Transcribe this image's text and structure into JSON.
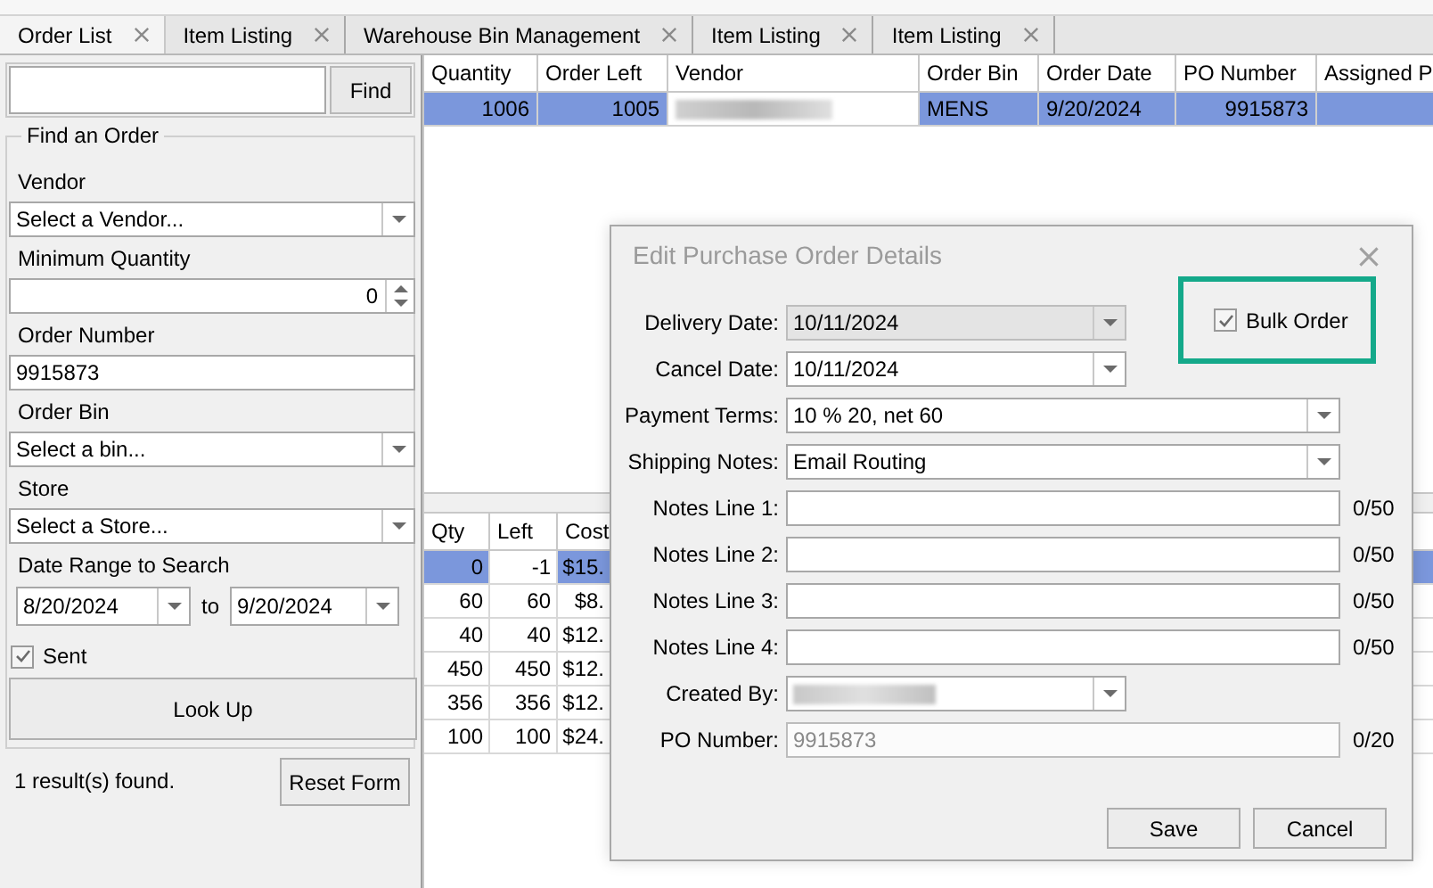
{
  "tabs": [
    {
      "label": "Order List",
      "selected": true
    },
    {
      "label": "Item Listing",
      "selected": false
    },
    {
      "label": "Warehouse Bin Management",
      "selected": false
    },
    {
      "label": "Item Listing",
      "selected": false
    },
    {
      "label": "Item Listing",
      "selected": false
    }
  ],
  "find_button": "Find",
  "filter_group": {
    "title": "Find an Order",
    "fields": [
      {
        "label": "Vendor",
        "kind": "select",
        "value": "Select a Vendor..."
      },
      {
        "label": "Minimum Quantity",
        "kind": "spinner",
        "value": "0"
      },
      {
        "label": "Order Number",
        "kind": "text",
        "value": "9915873"
      },
      {
        "label": "Order Bin",
        "kind": "select",
        "value": "Select a bin..."
      },
      {
        "label": "Store",
        "kind": "select",
        "value": "Select a Store..."
      },
      {
        "label": "Date Range to Search",
        "kind": "date_range",
        "from": "8/20/2024",
        "separator": "to",
        "to": "9/20/2024"
      }
    ],
    "sent": {
      "label": "Sent",
      "checked": true
    },
    "lookup_button": "Look Up"
  },
  "result_text": "1 result(s) found.",
  "reset_button": "Reset Form",
  "orders_table": {
    "columns": [
      "Quantity",
      "Order Left",
      "Vendor",
      "Order Bin",
      "Order Date",
      "PO Number",
      "Assigned P"
    ],
    "rows": [
      {
        "selected": true,
        "cells": [
          {
            "kind": "number",
            "text": "1006",
            "current": false
          },
          {
            "kind": "number",
            "text": "1005",
            "current": false
          },
          {
            "kind": "redacted",
            "current": true
          },
          {
            "kind": "text",
            "text": "MENS",
            "current": false
          },
          {
            "kind": "text",
            "text": "9/20/2024",
            "current": false
          },
          {
            "kind": "number",
            "text": "9915873",
            "current": false
          },
          {
            "kind": "text",
            "current": false
          }
        ]
      }
    ]
  },
  "lines_table": {
    "columns": [
      "Qty",
      "Left",
      "Cost"
    ],
    "rows": [
      {
        "selected": true,
        "cells": [
          {
            "text": "0",
            "current": false
          },
          {
            "text": "-1",
            "current": true
          },
          {
            "text": "$15.",
            "current": false
          }
        ]
      },
      {
        "selected": false,
        "cells": [
          {
            "text": "60"
          },
          {
            "text": "60"
          },
          {
            "text": "$8."
          }
        ]
      },
      {
        "selected": false,
        "cells": [
          {
            "text": "40"
          },
          {
            "text": "40"
          },
          {
            "text": "$12."
          }
        ]
      },
      {
        "selected": false,
        "cells": [
          {
            "text": "450"
          },
          {
            "text": "450"
          },
          {
            "text": "$12."
          }
        ]
      },
      {
        "selected": false,
        "cells": [
          {
            "text": "356"
          },
          {
            "text": "356"
          },
          {
            "text": "$12."
          }
        ]
      },
      {
        "selected": false,
        "cells": [
          {
            "text": "100"
          },
          {
            "text": "100"
          },
          {
            "text": "$24."
          }
        ]
      }
    ]
  },
  "dialog": {
    "title": "Edit Purchase Order Details",
    "bulk_order": {
      "label": "Bulk Order",
      "checked": true,
      "highlighted": true
    },
    "fields": [
      {
        "label": "Delivery Date:",
        "kind": "dropdown",
        "value": "10/11/2024",
        "disabled": true
      },
      {
        "label": "Cancel Date:",
        "kind": "dropdown",
        "value": "10/11/2024",
        "disabled": false
      },
      {
        "label": "Payment Terms:",
        "kind": "dropdown",
        "value": "10 % 20, net 60",
        "disabled": false
      },
      {
        "label": "Shipping Notes:",
        "kind": "dropdown",
        "value": "Email Routing",
        "disabled": false
      },
      {
        "label": "Notes Line 1:",
        "kind": "text",
        "counter": "0/50",
        "disabled": false
      },
      {
        "label": "Notes Line 2:",
        "kind": "text",
        "counter": "0/50",
        "disabled": false
      },
      {
        "label": "Notes Line 3:",
        "kind": "text",
        "counter": "0/50",
        "disabled": false
      },
      {
        "label": "Notes Line 4:",
        "kind": "text",
        "counter": "0/50",
        "disabled": false
      },
      {
        "label": "Created By:",
        "kind": "redacted_dropdown",
        "disabled": false
      },
      {
        "label": "PO Number:",
        "kind": "text",
        "value": "9915873",
        "counter": "0/20",
        "disabled": true
      }
    ],
    "buttons": [
      "Save",
      "Cancel"
    ]
  }
}
